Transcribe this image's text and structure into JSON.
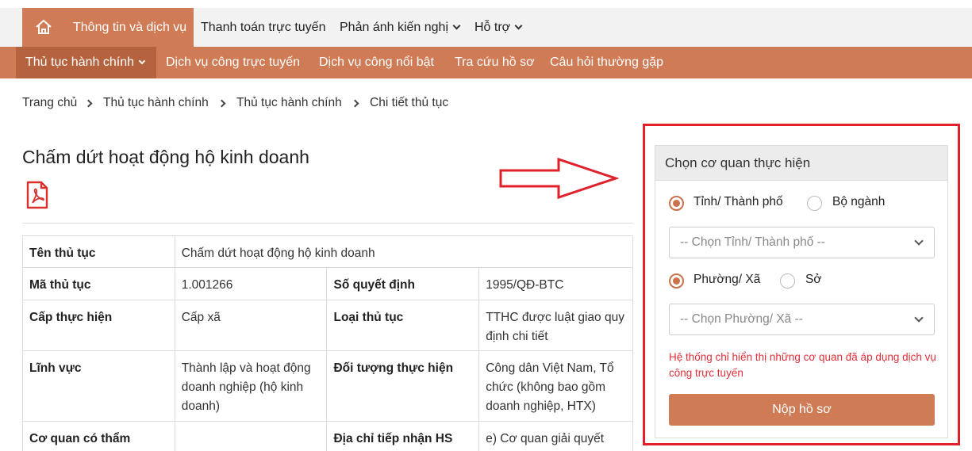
{
  "top_nav": {
    "items": [
      {
        "label": "Thông tin và dịch vụ"
      },
      {
        "label": "Thanh toán trực tuyến"
      },
      {
        "label": "Phản ánh kiến nghị"
      },
      {
        "label": "Hỗ trợ"
      }
    ],
    "home_icon": "home-icon",
    "accent": "#cf7b55"
  },
  "sub_nav": {
    "items": [
      {
        "label": "Thủ tục hành chính"
      },
      {
        "label": "Dịch vụ công trực tuyến"
      },
      {
        "label": "Dịch vụ công nổi bật"
      },
      {
        "label": "Tra cứu hồ sơ"
      },
      {
        "label": "Câu hỏi thường gặp"
      }
    ]
  },
  "breadcrumb": [
    "Trang chủ",
    "Thủ tục hành chính",
    "Thủ tục hành chính",
    "Chi tiết thủ tục"
  ],
  "page": {
    "title": "Chấm dứt hoạt động hộ kinh doanh",
    "pdf_icon": "pdf-icon"
  },
  "info_table": {
    "ten_thu_tuc": {
      "label": "Tên thủ tục",
      "value": "Chấm dứt hoạt động hộ kinh doanh"
    },
    "ma_thu_tuc": {
      "label": "Mã thủ tục",
      "value": "1.001266"
    },
    "so_quyet_dinh": {
      "label": "Số quyết định",
      "value": "1995/QĐ-BTC"
    },
    "cap_thuc_hien": {
      "label": "Cấp thực hiện",
      "value": "Cấp xã"
    },
    "loai_thu_tuc": {
      "label": "Loại thủ tục",
      "value": "TTHC được luật giao quy định chi tiết"
    },
    "linh_vuc": {
      "label": "Lĩnh vực",
      "value": "Thành lập và hoạt động doanh nghiệp (hộ kinh doanh)"
    },
    "doi_tuong": {
      "label": "Đối tượng thực hiện",
      "value": "Công dân Việt Nam, Tổ chức (không bao gồm doanh nghiệp, HTX)"
    },
    "co_quan": {
      "label": "Cơ quan có thẩm quyền",
      "value": ""
    },
    "dia_chi": {
      "label": "Địa chỉ tiếp nhận HS",
      "value": "e) Cơ quan giải quyết"
    }
  },
  "panel": {
    "title": "Chọn cơ quan thực hiện",
    "radio_group1": {
      "option1": "Tỉnh/ Thành phố",
      "option2": "Bộ ngành",
      "selected": "option1"
    },
    "select1_placeholder": "-- Chọn Tỉnh/ Thành phố --",
    "radio_group2": {
      "option1": "Phường/ Xã",
      "option2": "Sở",
      "selected": "option1"
    },
    "select2_placeholder": "-- Chọn Phường/ Xã --",
    "note": "Hệ thống chỉ hiển thị những cơ quan đã áp dụng dịch vụ công trực tuyến",
    "submit_label": "Nộp hồ sơ"
  },
  "annotation": {
    "arrow_color": "#e0202a",
    "box_color": "#e0202a"
  }
}
